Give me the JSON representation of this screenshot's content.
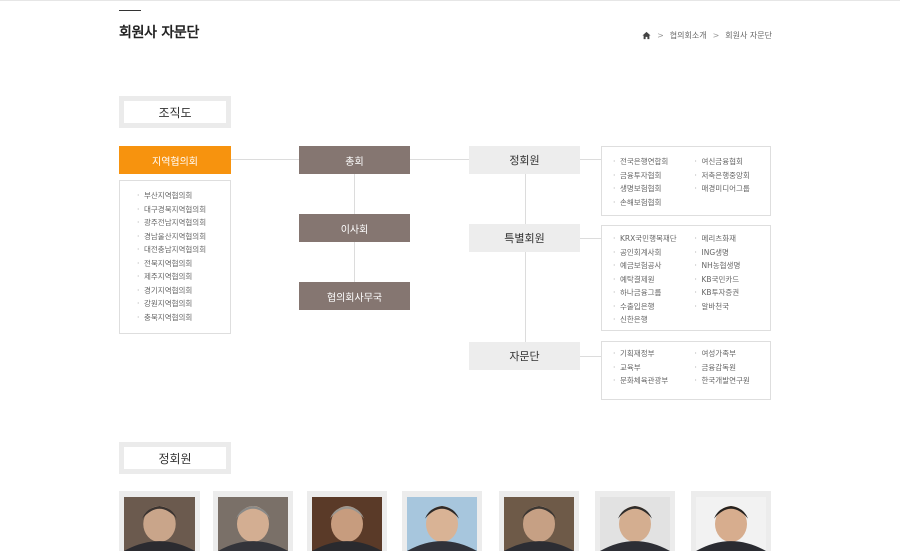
{
  "header": {
    "title": "회원사 자문단",
    "breadcrumb": [
      "협의회소개",
      "회원사 자문단"
    ]
  },
  "org": {
    "section_label": "조직도",
    "nodes": {
      "regional": "지역협의회",
      "general": "총회",
      "board": "이사회",
      "secretariat": "협의회사무국",
      "regular": "정회원",
      "special": "특별회원",
      "advisory": "자문단"
    },
    "regional_list": [
      "부산지역협의회",
      "대구경북지역협의회",
      "광주전남지역협의회",
      "경남울산지역협의회",
      "대전충남지역협의회",
      "전북지역협의회",
      "제주지역협의회",
      "경기지역협의회",
      "강원지역협의회",
      "충북지역협의회"
    ],
    "regular_list": [
      "전국은행연합회",
      "여신금융협회",
      "금융투자협회",
      "저축은행중앙회",
      "생명보험협회",
      "매경미디어그룹",
      "손해보험협회"
    ],
    "special_list": [
      "KRX국민행복재단",
      "메리츠화재",
      "공인회계사회",
      "ING생명",
      "예금보험공사",
      "NH농협생명",
      "예탁결제원",
      "KB국민카드",
      "하나금융그룹",
      "KB투자증권",
      "수출입은행",
      "알바천국",
      "신한은행"
    ],
    "advisory_list": [
      "기획재정부",
      "여성가족부",
      "교육부",
      "금융감독원",
      "문화체육관광부",
      "한국개발연구원"
    ]
  },
  "members": {
    "section_label": "정회원",
    "photos": [
      "member-photo-1",
      "member-photo-2",
      "member-photo-3",
      "member-photo-4",
      "member-photo-5",
      "member-photo-6",
      "member-photo-7"
    ]
  },
  "colors": {
    "accent": "#f7930e",
    "brown": "#857671",
    "gray": "#ededed"
  }
}
